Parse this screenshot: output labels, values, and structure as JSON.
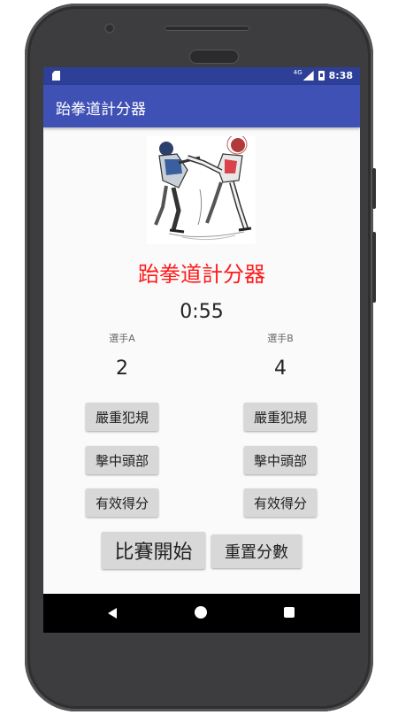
{
  "colors": {
    "status_bar": "#2d3f97",
    "app_bar": "#3f51b5",
    "heading": "#ff1a1a",
    "button_bg": "#d8d8d8",
    "nav_bar": "#000000"
  },
  "status_bar": {
    "network": "4G",
    "time": "8:38",
    "icons": [
      "sim-card-icon",
      "signal-icon",
      "battery-icon"
    ]
  },
  "app_bar": {
    "title": "跆拳道計分器"
  },
  "main": {
    "image": "taekwondo-fighters-illustration",
    "heading": "跆拳道計分器",
    "timer": "0:55",
    "player_a": {
      "label": "選手A",
      "score": "2",
      "buttons": [
        "嚴重犯規",
        "擊中頭部",
        "有效得分"
      ]
    },
    "player_b": {
      "label": "選手B",
      "score": "4",
      "buttons": [
        "嚴重犯規",
        "擊中頭部",
        "有效得分"
      ]
    },
    "start_button": "比賽開始",
    "reset_button": "重置分數"
  },
  "nav_bar": {
    "icons": [
      "back-icon",
      "home-icon",
      "recents-icon"
    ]
  }
}
